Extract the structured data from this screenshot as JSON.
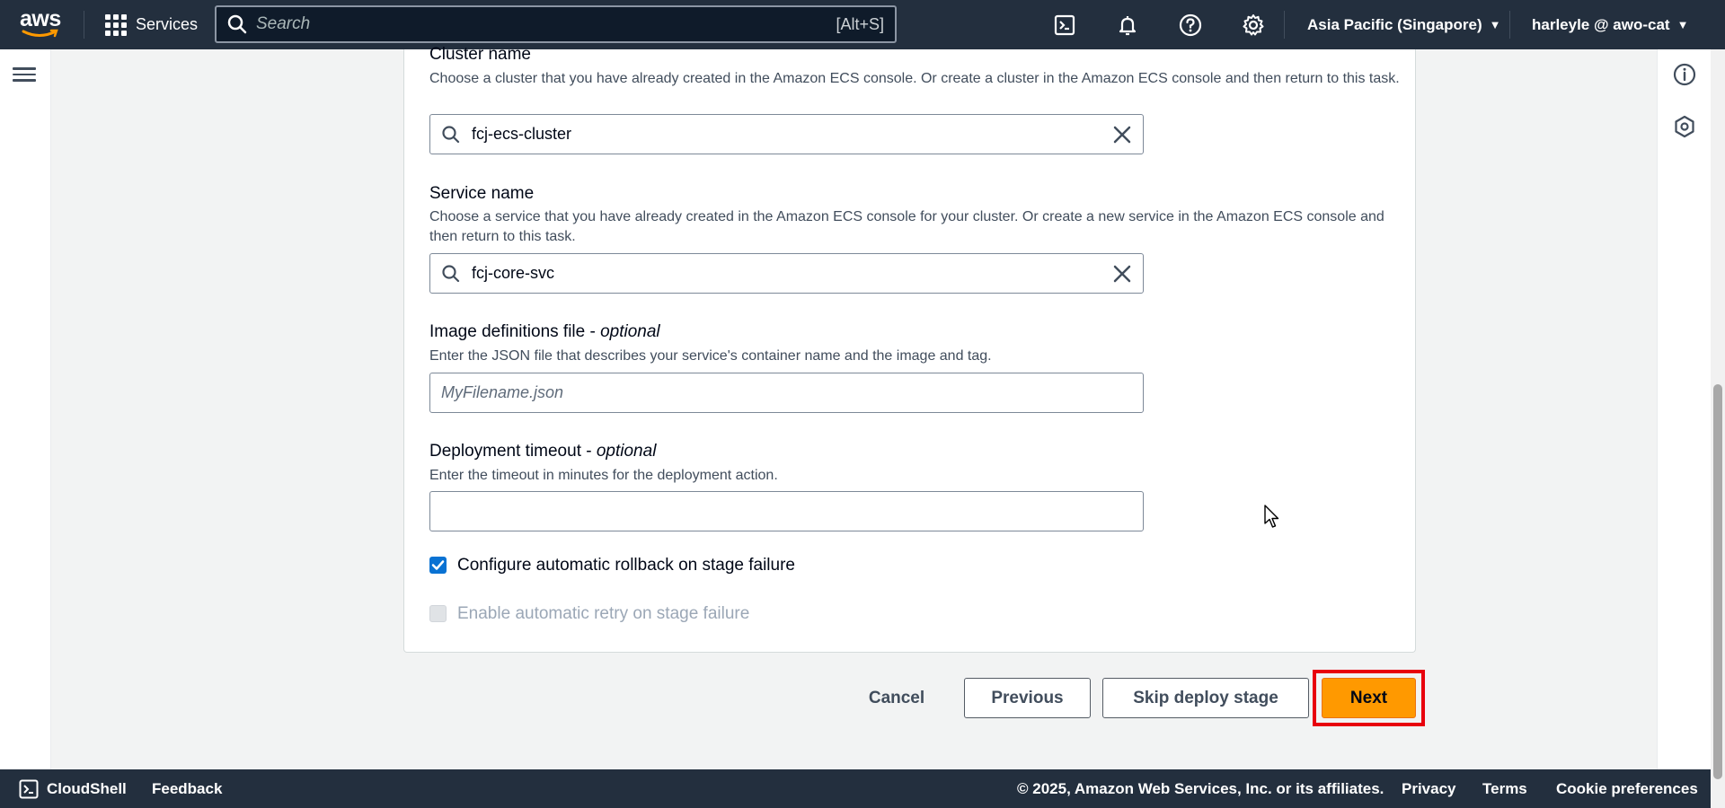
{
  "topnav": {
    "logo_text": "aws",
    "services_label": "Services",
    "search_placeholder": "Search",
    "search_shortcut": "[Alt+S]",
    "icons": [
      "cloudshell-icon",
      "bell-icon",
      "help-icon",
      "gear-icon"
    ],
    "region": "Asia Pacific (Singapore)",
    "user": "harleyle @ awo-cat"
  },
  "form": {
    "cluster": {
      "label": "Cluster name",
      "description": "Choose a cluster that you have already created in the Amazon ECS console. Or create a cluster in the Amazon ECS console and then return to this task.",
      "value": "fcj-ecs-cluster"
    },
    "service": {
      "label": "Service name",
      "description": "Choose a service that you have already created in the Amazon ECS console for your cluster. Or create a new service in the Amazon ECS console and then return to this task.",
      "value": "fcj-core-svc"
    },
    "image_defs": {
      "label": "Image definitions file - ",
      "label_optional": "optional",
      "description": "Enter the JSON file that describes your service's container name and the image and tag.",
      "placeholder": "MyFilename.json"
    },
    "timeout": {
      "label": "Deployment timeout - ",
      "label_optional": "optional",
      "description": "Enter the timeout in minutes for the deployment action.",
      "value": ""
    },
    "rollback": {
      "label": "Configure automatic rollback on stage failure",
      "checked": true
    },
    "retry": {
      "label": "Enable automatic retry on stage failure",
      "checked": false,
      "disabled": true
    }
  },
  "actions": {
    "cancel": "Cancel",
    "previous": "Previous",
    "skip": "Skip deploy stage",
    "next": "Next"
  },
  "footer": {
    "cloudshell": "CloudShell",
    "feedback": "Feedback",
    "copyright": "© 2025, Amazon Web Services, Inc. or its affiliates.",
    "privacy": "Privacy",
    "terms": "Terms",
    "cookies": "Cookie preferences"
  },
  "colors": {
    "nav_bg": "#232f3e",
    "primary_button": "#ff9900",
    "checkbox_on": "#0972d3",
    "highlight_box": "#e8000d"
  }
}
